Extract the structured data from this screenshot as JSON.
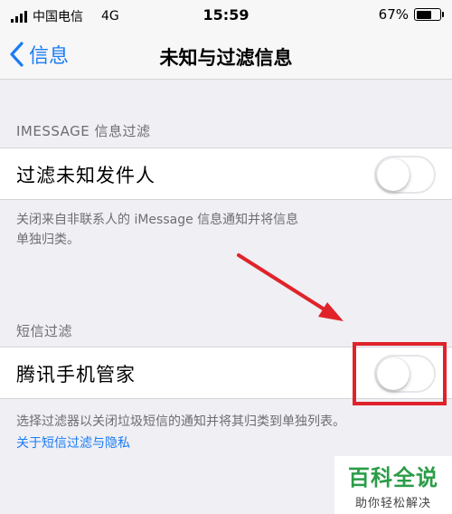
{
  "status_bar": {
    "carrier": "中国电信",
    "network": "4G",
    "time": "15:59",
    "battery_percent": "67%",
    "battery_level": 0.67
  },
  "nav": {
    "back_label": "信息",
    "title": "未知与过滤信息"
  },
  "imessage_section": {
    "header": "IMESSAGE 信息过滤",
    "cell_label": "过滤未知发件人",
    "toggle_on": false,
    "footer_line1": "关闭来自非联系人的 iMessage 信息通知并将信息",
    "footer_line2": "单独归类。"
  },
  "sms_section": {
    "header": "短信过滤",
    "cell_label": "腾讯手机管家",
    "toggle_on": false,
    "footer": "选择过滤器以关闭垃圾短信的通知并将其归类到单独列表。",
    "link": "关于短信过滤与隐私"
  },
  "watermark": {
    "brand": "百科全说",
    "slogan": "助你轻松解决"
  },
  "colors": {
    "accent": "#1a7cf5",
    "annotation_red": "#e0232a",
    "watermark_green": "#2a9d47"
  }
}
